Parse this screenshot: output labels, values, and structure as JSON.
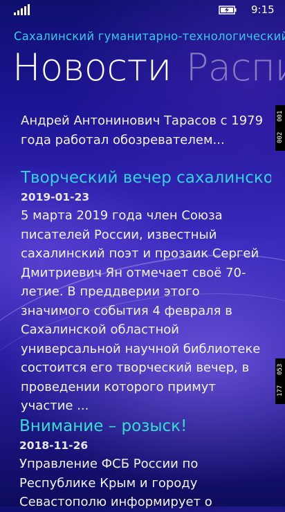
{
  "status_bar": {
    "time": "9:15"
  },
  "app_title": "Сахалинский гуманитарно-технологический",
  "pivots": [
    {
      "label": "Новости",
      "active": true
    },
    {
      "label": "Расписание",
      "active": false
    }
  ],
  "news": [
    {
      "title": "",
      "date": "",
      "text": "Андрей Антонинович Тарасов с 1979 года работал обозревателем..."
    },
    {
      "title": "Творческий вечер сахалинского",
      "date": "2019-01-23",
      "text": "5 марта 2019 года член Союза писателей России, известный сахалинский поэт и прозаик Сергей Дмитриевич Ян отмечает своё 70-летие. В преддверии этого значимого события 4 февраля в Сахалинской областной универсальной научной библиотеке состоится его творческий вечер, в проведении которого примут участие ..."
    },
    {
      "title": "Внимание – розыск!",
      "date": "2018-11-26",
      "text": "Управление ФСБ России по Республике Крым и городу Севастополю информирует о"
    }
  ],
  "scroll_markers": [
    {
      "top": "001",
      "bottom": "002"
    },
    {
      "top": "053",
      "bottom": "177"
    }
  ],
  "colors": {
    "accent": "#36c9e8",
    "title_teal": "#33e0d0",
    "background": "#2a1ea3"
  }
}
